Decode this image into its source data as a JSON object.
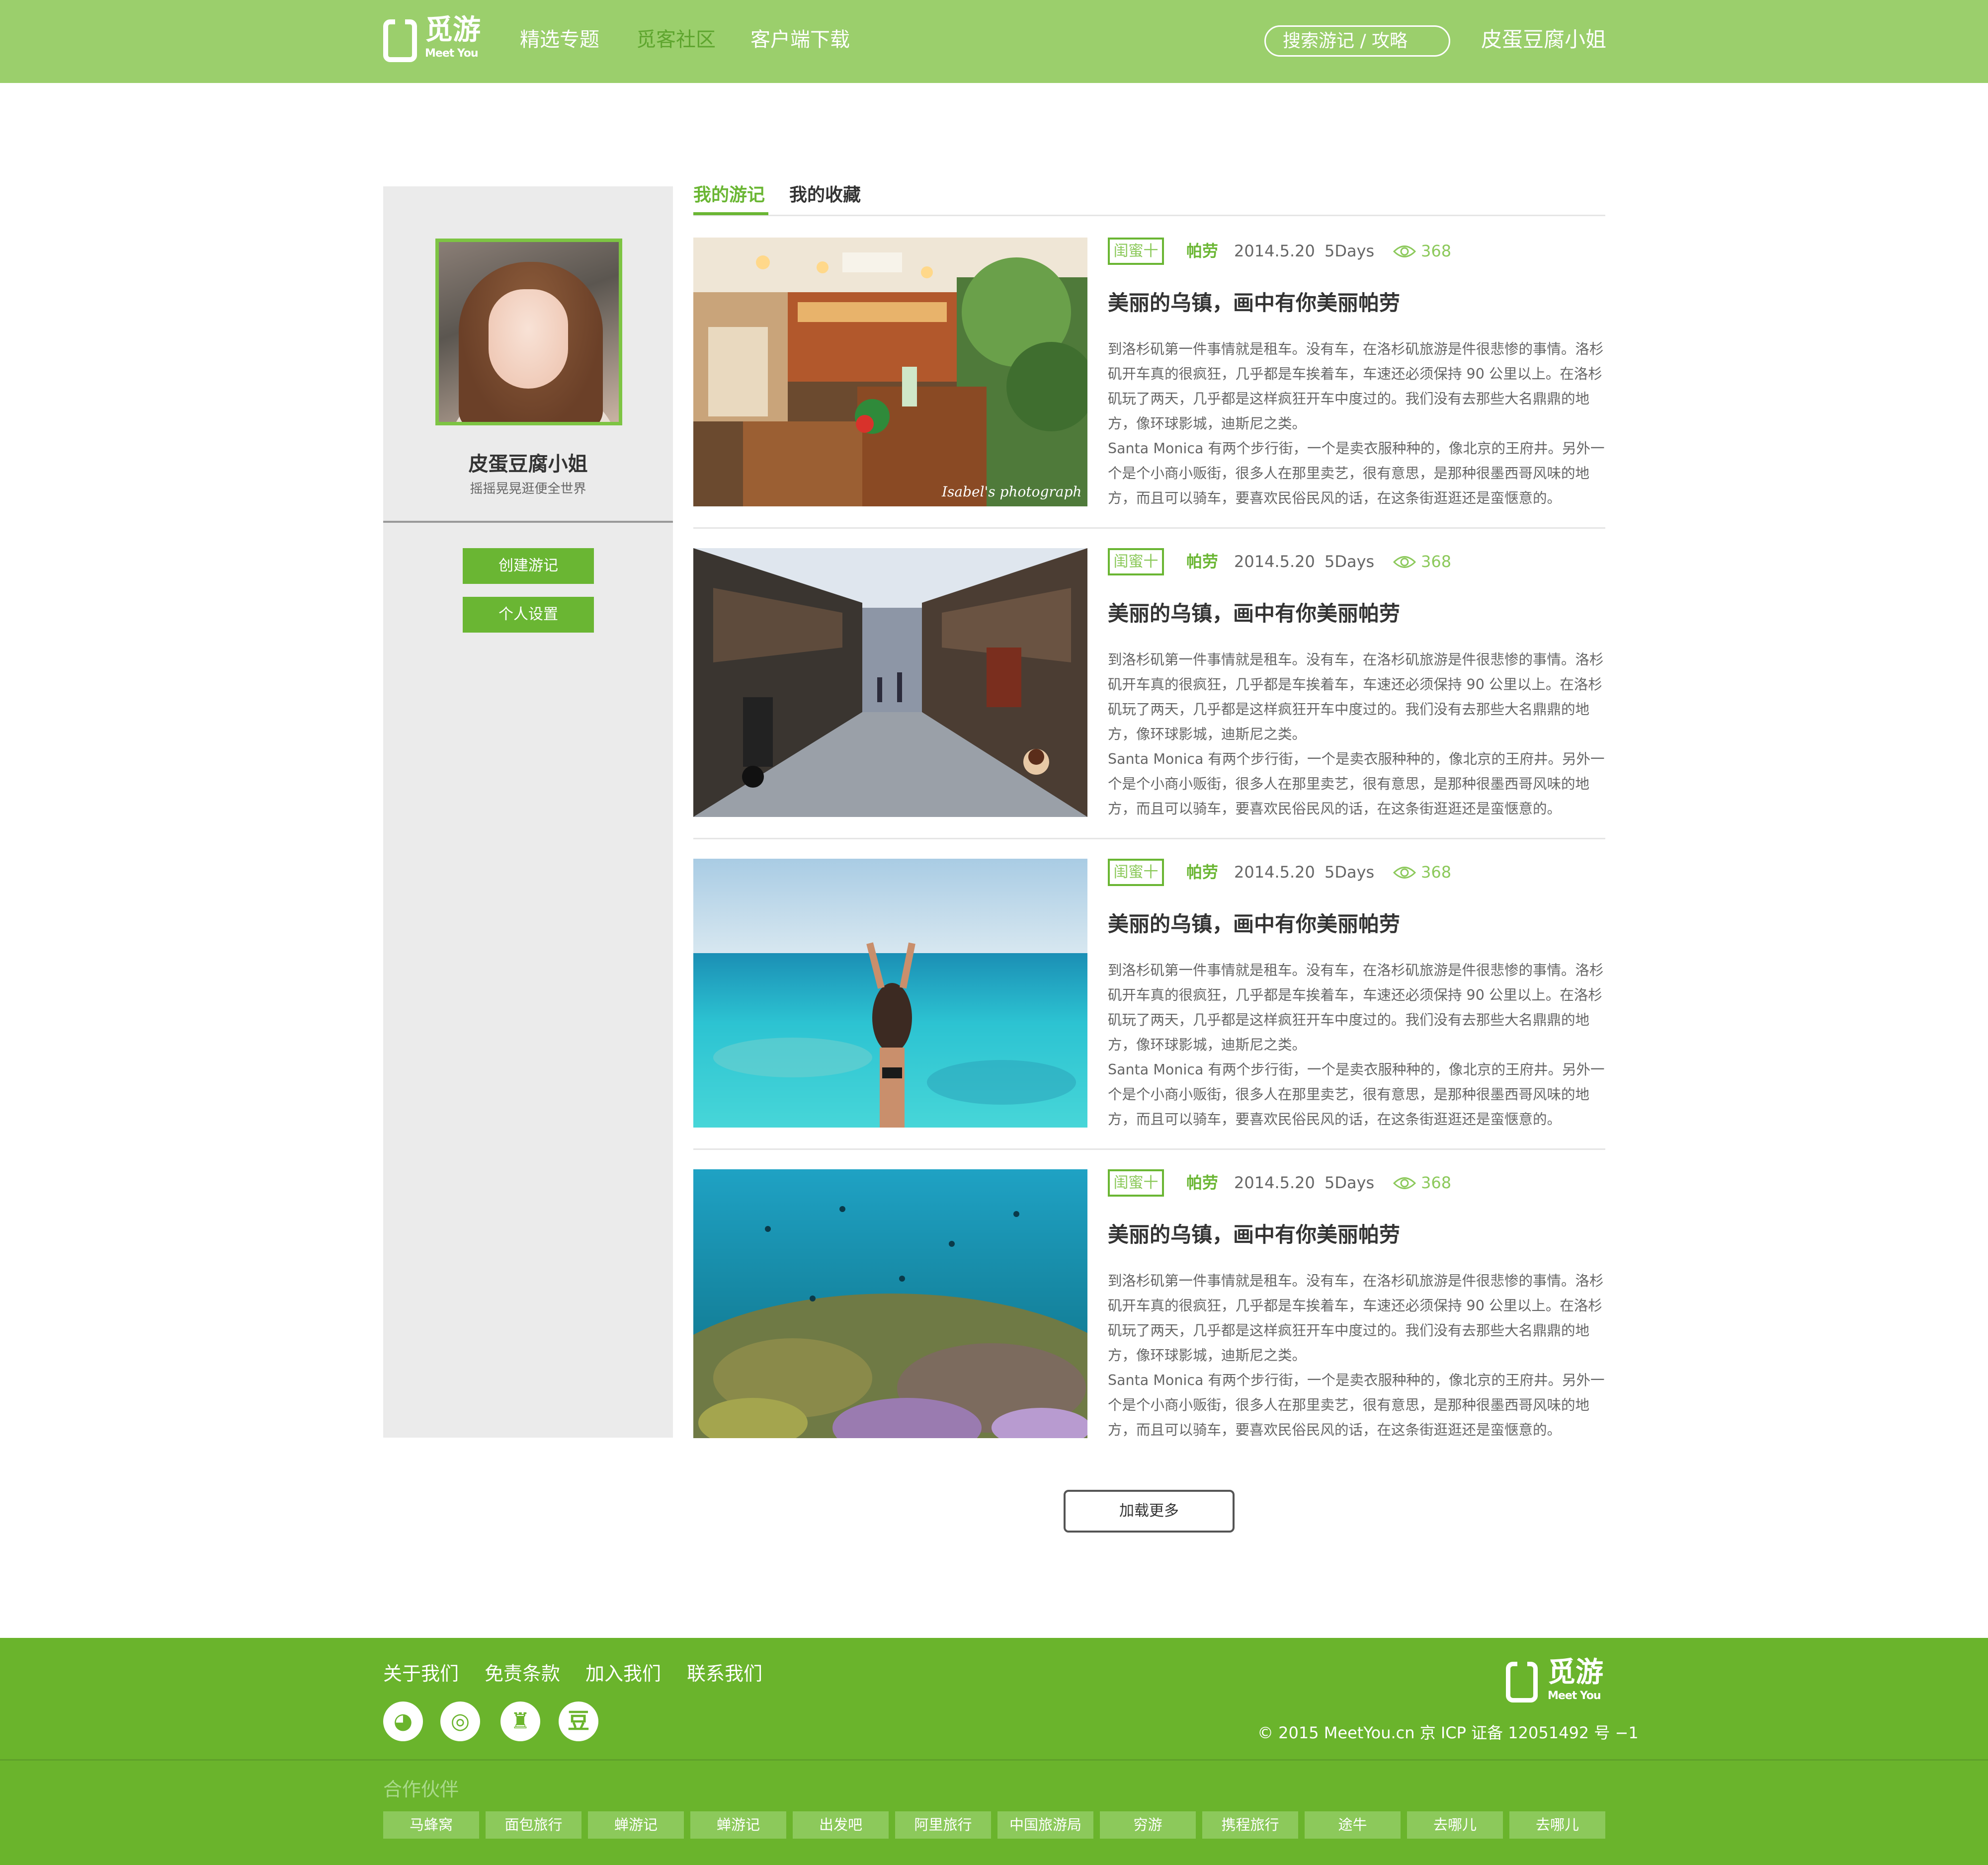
{
  "header": {
    "logo_text": "觅游",
    "logo_sub": "Meet You",
    "nav": [
      "精选专题",
      "觅客社区",
      "客户端下载"
    ],
    "search_placeholder": "搜索游记 / 攻略",
    "username": "皮蛋豆腐小姐"
  },
  "profile": {
    "name": "皮蛋豆腐小姐",
    "tagline": "摇摇晃晃逛便全世界",
    "buttons": [
      "创建游记",
      "个人设置"
    ]
  },
  "tabs": [
    "我的游记",
    "我的收藏"
  ],
  "articles": [
    {
      "badge": "闺蜜十",
      "place": "帕劳",
      "date": "2014.5.20",
      "days": "5Days",
      "views": "368",
      "title": "美丽的乌镇，画中有你美丽帕劳",
      "body1": "到洛杉矶第一件事情就是租车。没有车，在洛杉矶旅游是件很悲惨的事情。洛杉矶开车真的很疯狂，几乎都是车挨着车，车速还必须保持 90 公里以上。在洛杉矶玩了两天，几乎都是这样疯狂开车中度过的。我们没有去那些大名鼎鼎的地方，像环球影城，迪斯尼之类。",
      "body2": "Santa Monica 有两个步行街，一个是卖衣服种种的，像北京的王府井。另外一个是个小商小贩街，很多人在那里卖艺，很有意思，是那种很墨西哥风味的地方，而且可以骑车，要喜欢民俗民风的话，在这条街逛逛还是蛮惬意的。",
      "photo_caption": "Isabel's photograph"
    },
    {
      "badge": "闺蜜十",
      "place": "帕劳",
      "date": "2014.5.20",
      "days": "5Days",
      "views": "368",
      "title": "美丽的乌镇，画中有你美丽帕劳",
      "body1": "到洛杉矶第一件事情就是租车。没有车，在洛杉矶旅游是件很悲惨的事情。洛杉矶开车真的很疯狂，几乎都是车挨着车，车速还必须保持 90 公里以上。在洛杉矶玩了两天，几乎都是这样疯狂开车中度过的。我们没有去那些大名鼎鼎的地方，像环球影城，迪斯尼之类。",
      "body2": "Santa Monica 有两个步行街，一个是卖衣服种种的，像北京的王府井。另外一个是个小商小贩街，很多人在那里卖艺，很有意思，是那种很墨西哥风味的地方，而且可以骑车，要喜欢民俗民风的话，在这条街逛逛还是蛮惬意的。"
    },
    {
      "badge": "闺蜜十",
      "place": "帕劳",
      "date": "2014.5.20",
      "days": "5Days",
      "views": "368",
      "title": "美丽的乌镇，画中有你美丽帕劳",
      "body1": "到洛杉矶第一件事情就是租车。没有车，在洛杉矶旅游是件很悲惨的事情。洛杉矶开车真的很疯狂，几乎都是车挨着车，车速还必须保持 90 公里以上。在洛杉矶玩了两天，几乎都是这样疯狂开车中度过的。我们没有去那些大名鼎鼎的地方，像环球影城，迪斯尼之类。",
      "body2": "Santa Monica 有两个步行街，一个是卖衣服种种的，像北京的王府井。另外一个是个小商小贩街，很多人在那里卖艺，很有意思，是那种很墨西哥风味的地方，而且可以骑车，要喜欢民俗民风的话，在这条街逛逛还是蛮惬意的。"
    },
    {
      "badge": "闺蜜十",
      "place": "帕劳",
      "date": "2014.5.20",
      "days": "5Days",
      "views": "368",
      "title": "美丽的乌镇，画中有你美丽帕劳",
      "body1": "到洛杉矶第一件事情就是租车。没有车，在洛杉矶旅游是件很悲惨的事情。洛杉矶开车真的很疯狂，几乎都是车挨着车，车速还必须保持 90 公里以上。在洛杉矶玩了两天，几乎都是这样疯狂开车中度过的。我们没有去那些大名鼎鼎的地方，像环球影城，迪斯尼之类。",
      "body2": "Santa Monica 有两个步行街，一个是卖衣服种种的，像北京的王府井。另外一个是个小商小贩街，很多人在那里卖艺，很有意思，是那种很墨西哥风味的地方，而且可以骑车，要喜欢民俗民风的话，在这条街逛逛还是蛮惬意的。"
    }
  ],
  "load_more": "加载更多",
  "footer": {
    "links": [
      "关于我们",
      "免责条款",
      "加入我们",
      "联系我们"
    ],
    "social": [
      {
        "icon": "wechat-icon",
        "glyph": "◕"
      },
      {
        "icon": "weibo-icon",
        "glyph": "◎"
      },
      {
        "icon": "qq-icon",
        "glyph": "♜"
      },
      {
        "icon": "douban-icon",
        "glyph": "豆"
      }
    ],
    "logo_text": "觅游",
    "logo_sub": "Meet You",
    "copyright": "© 2015 MeetYou.cn   京 ICP 证备 12051492 号 −1",
    "partners_title": "合作伙伴",
    "partners": [
      "马蜂窝",
      "面包旅行",
      "蝉游记",
      "蝉游记",
      "出发吧",
      "阿里旅行",
      "中国旅游局",
      "穷游",
      "携程旅行",
      "途牛",
      "去哪儿",
      "去哪儿"
    ]
  },
  "colors": {
    "header_bg": "#9bcf6c",
    "accent": "#6ab633",
    "footer_bg": "#6ab42c",
    "sidebar_bg": "#ebebeb"
  }
}
